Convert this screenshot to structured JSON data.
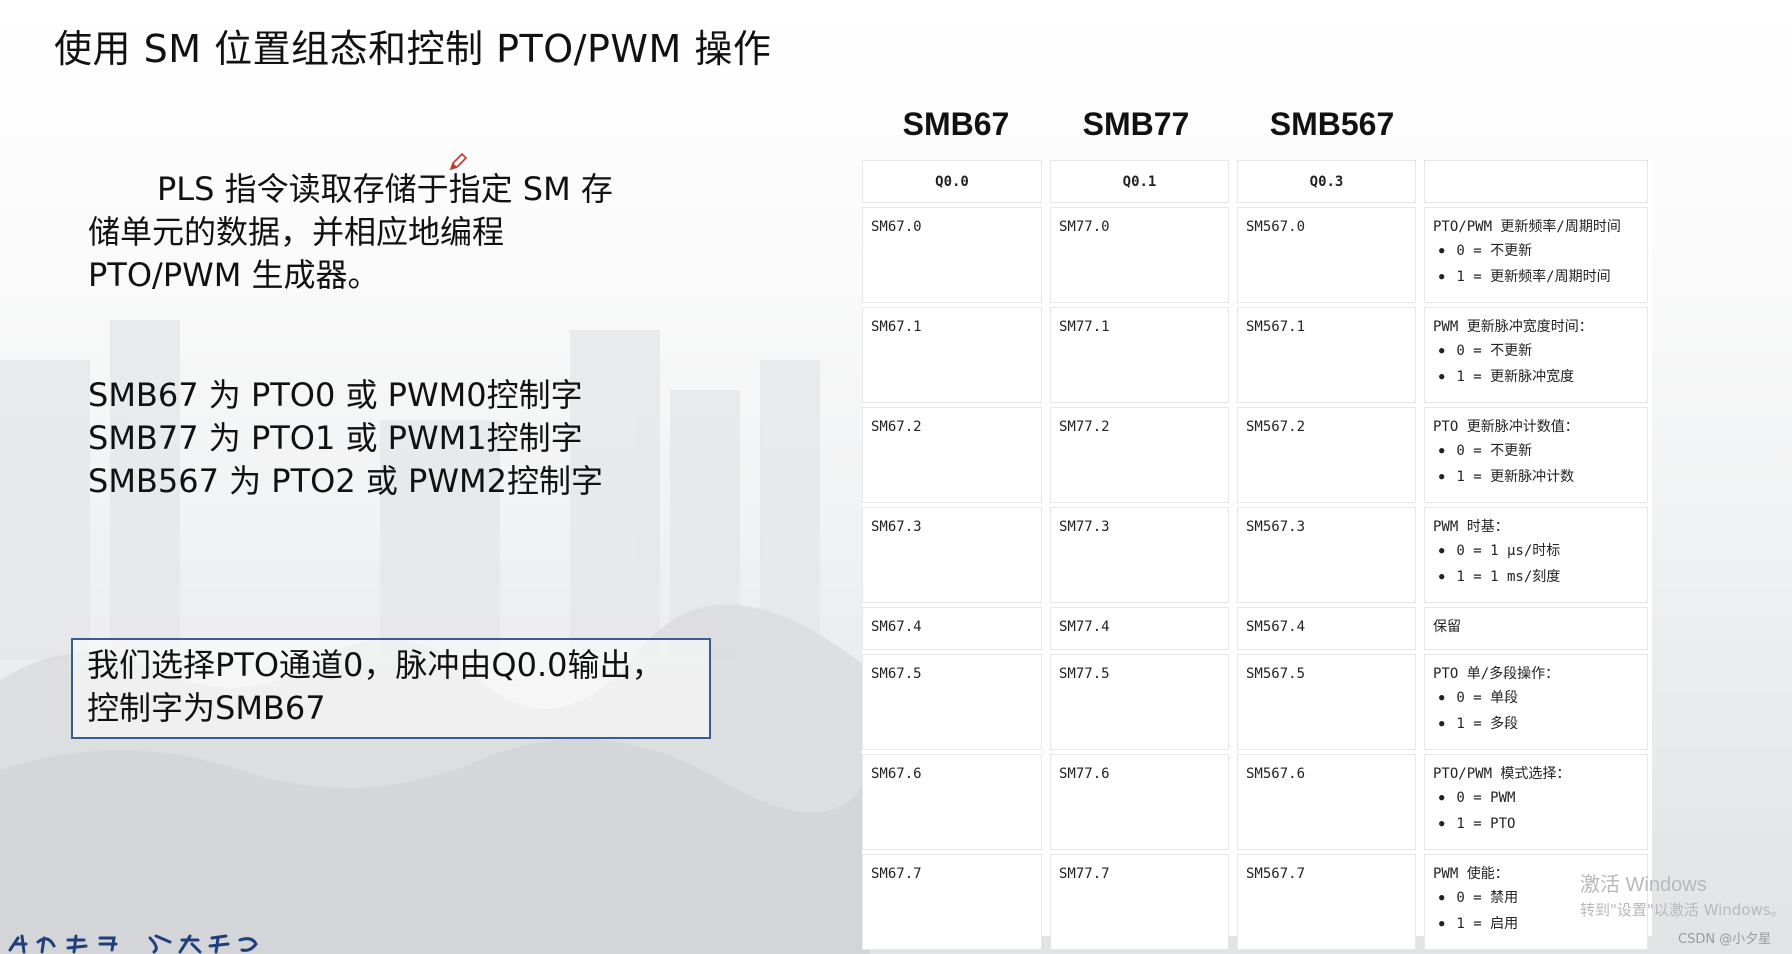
{
  "title": "使用 SM 位置组态和控制 PTO/PWM 操作",
  "intro_lines": [
    "PLS 指令读取存储于指定 SM 存",
    "储单元的数据，并相应地编程",
    "PTO/PWM 生成器。"
  ],
  "control_lines": [
    "SMB67 为 PTO0 或 PWM0控制字",
    "SMB77 为 PTO1 或 PWM1控制字",
    "SMB567 为 PTO2 或 PWM2控制字"
  ],
  "note_lines": [
    "我们选择PTO通道0，脉冲由Q0.0输出，",
    "控制字为SMB67"
  ],
  "columns": [
    "SMB67",
    "SMB77",
    "SMB567"
  ],
  "outputs": [
    "Q0.0",
    "Q0.1",
    "Q0.3"
  ],
  "rows": [
    {
      "bits": [
        "SM67.0",
        "SM77.0",
        "SM567.0"
      ],
      "title": "PTO/PWM 更新频率/周期时间",
      "options": [
        "0 = 不更新",
        "1 = 更新频率/周期时间"
      ]
    },
    {
      "bits": [
        "SM67.1",
        "SM77.1",
        "SM567.1"
      ],
      "title": "PWM 更新脉冲宽度时间：",
      "options": [
        "0 = 不更新",
        "1 = 更新脉冲宽度"
      ]
    },
    {
      "bits": [
        "SM67.2",
        "SM77.2",
        "SM567.2"
      ],
      "title": "PTO 更新脉冲计数值：",
      "options": [
        "0 = 不更新",
        "1 = 更新脉冲计数"
      ]
    },
    {
      "bits": [
        "SM67.3",
        "SM77.3",
        "SM567.3"
      ],
      "title": "PWM 时基：",
      "options": [
        "0 = 1 μs/时标",
        "1 = 1 ms/刻度"
      ]
    },
    {
      "bits": [
        "SM67.4",
        "SM77.4",
        "SM567.4"
      ],
      "title": "保留",
      "options": []
    },
    {
      "bits": [
        "SM67.5",
        "SM77.5",
        "SM567.5"
      ],
      "title": "PTO 单/多段操作：",
      "options": [
        "0 = 单段",
        "1 = 多段"
      ]
    },
    {
      "bits": [
        "SM67.6",
        "SM77.6",
        "SM567.6"
      ],
      "title": "PTO/PWM 模式选择：",
      "options": [
        "0 = PWM",
        "1 = PTO"
      ]
    },
    {
      "bits": [
        "SM67.7",
        "SM77.7",
        "SM567.7"
      ],
      "title": "PWM 使能：",
      "options": [
        "0 = 禁用",
        "1 = 启用"
      ]
    }
  ],
  "watermark": {
    "line1": "激活 Windows",
    "line2": "转到\"设置\"以激活 Windows。"
  },
  "credit": "CSDN @小夕星",
  "colors": {
    "note_border": "#3a5a9a",
    "text": "#111111",
    "cell_border": "#e6e6e6"
  },
  "icons": [
    "pen-cursor-icon"
  ]
}
